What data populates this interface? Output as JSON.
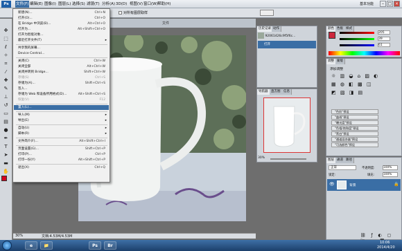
{
  "app": {
    "logo": "Ps",
    "workspace": "基本功能"
  },
  "menubar": {
    "items": [
      "文件(F)",
      "编辑(E)",
      "图像(I)",
      "图层(L)",
      "选择(S)",
      "滤镜(T)",
      "分析(A)",
      "3D(D)",
      "视图(V)",
      "窗口(W)",
      "帮助(H)"
    ],
    "active_index": 0
  },
  "options": {
    "checkbox_label": "对所有图层取样"
  },
  "document": {
    "tab_label": "文件",
    "zoom": "30%",
    "doc_info": "文档:4.53M/4.53M"
  },
  "file_menu": {
    "items": [
      {
        "label": "新建(N)...",
        "shortcut": "Ctrl+N"
      },
      {
        "label": "打开(O)...",
        "shortcut": "Ctrl+O"
      },
      {
        "label": "在 Bridge 中浏览(B)...",
        "shortcut": "Alt+Ctrl+O"
      },
      {
        "label": "打开为...",
        "shortcut": "Alt+Shift+Ctrl+O"
      },
      {
        "label": "打开为智能对象..."
      },
      {
        "label": "最近打开文件(T)",
        "arrow": "▸"
      },
      {
        "sep": true
      },
      {
        "label": "共享我的屏幕..."
      },
      {
        "label": "Device Central..."
      },
      {
        "sep": true
      },
      {
        "label": "关闭(C)",
        "shortcut": "Ctrl+W"
      },
      {
        "label": "关闭全部",
        "shortcut": "Alt+Ctrl+W"
      },
      {
        "label": "关闭并转到 Bridge...",
        "shortcut": "Shift+Ctrl+W"
      },
      {
        "label": "存储(S)",
        "shortcut": "Ctrl+S",
        "disabled": true
      },
      {
        "label": "存储为(A)...",
        "shortcut": "Shift+Ctrl+S"
      },
      {
        "label": "签入..."
      },
      {
        "label": "存储为 Web 和设备所用格式(D)...",
        "shortcut": "Alt+Shift+Ctrl+S"
      },
      {
        "label": "恢复(V)",
        "shortcut": "F12",
        "disabled": true
      },
      {
        "sep": true
      },
      {
        "label": "置入(L)...",
        "highlight": true
      },
      {
        "sep": true
      },
      {
        "label": "导入(M)",
        "arrow": "▸"
      },
      {
        "label": "导出(E)",
        "arrow": "▸"
      },
      {
        "sep": true
      },
      {
        "label": "自动(U)",
        "arrow": "▸"
      },
      {
        "label": "脚本(R)",
        "arrow": "▸"
      },
      {
        "sep": true
      },
      {
        "label": "文件简介(F)...",
        "shortcut": "Alt+Shift+Ctrl+I"
      },
      {
        "sep": true
      },
      {
        "label": "页面设置(G)...",
        "shortcut": "Shift+Ctrl+P"
      },
      {
        "label": "打印(P)...",
        "shortcut": "Ctrl+P"
      },
      {
        "label": "打印一份(Y)",
        "shortcut": "Alt+Shift+Ctrl+P"
      },
      {
        "sep": true
      },
      {
        "label": "退出(X)",
        "shortcut": "Ctrl+Q"
      }
    ]
  },
  "history": {
    "tabs": [
      "历史记录",
      "动作"
    ],
    "snapshot": "92061426c9f5f6c...",
    "items": [
      "打开"
    ]
  },
  "navigator": {
    "tabs": [
      "导航器",
      "直方图",
      "信息"
    ],
    "zoom": "30%"
  },
  "color_panel": {
    "tabs": [
      "颜色",
      "色板",
      "样式"
    ],
    "r": "205",
    "g": "39",
    "b": "61",
    "swatch": "#cd273d"
  },
  "adjustments": {
    "tabs": [
      "调整",
      "蒙版"
    ],
    "title": "添加调整",
    "presets": [
      "\"色阶\"预设",
      "\"曲线\"预设",
      "\"曝光度\"预设",
      "\"色相/饱和度\"预设",
      "\"黑白\"预设",
      "\"通道混合器\"预设",
      "\"可选颜色\"预设"
    ]
  },
  "layers": {
    "tabs": [
      "图层",
      "通道",
      "路径"
    ],
    "blend": "正常",
    "opacity_label": "不透明度:",
    "opacity": "100%",
    "lock_label": "锁定:",
    "fill_label": "填充:",
    "fill": "100%",
    "layer_name": "背景"
  },
  "taskbar": {
    "apps": [
      "e",
      "📁",
      "Ps",
      "Br",
      "Ps"
    ],
    "time": "10:06",
    "date": "2014/4/20"
  }
}
